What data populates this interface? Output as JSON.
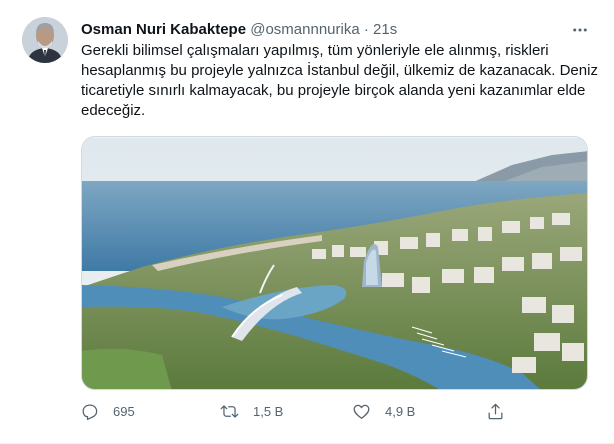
{
  "tweet": {
    "author_name": "Osman Nuri Kabaktepe",
    "handle": "@osmannnurika",
    "separator": "·",
    "time": "21s",
    "text": "Gerekli bilimsel çalışmaları yapılmış, tüm yönleriyle ele alınmış, riskleri hesaplanmış bu projeyle yalnızca İstanbul değil, ülkemiz de kazanacak. Deniz ticaretiyle sınırlı kalmayacak, bu projeyle birçok alanda yeni kazanımlar elde edeceğiz."
  },
  "actions": {
    "reply_count": "695",
    "retweet_count": "1,5 B",
    "like_count": "4,9 B"
  },
  "icons": {
    "more": "more-dots-icon",
    "reply": "reply-icon",
    "retweet": "retweet-icon",
    "like": "heart-icon",
    "share": "share-icon"
  },
  "colors": {
    "text": "#0f1419",
    "secondary": "#536471",
    "border": "#cfd9de"
  }
}
